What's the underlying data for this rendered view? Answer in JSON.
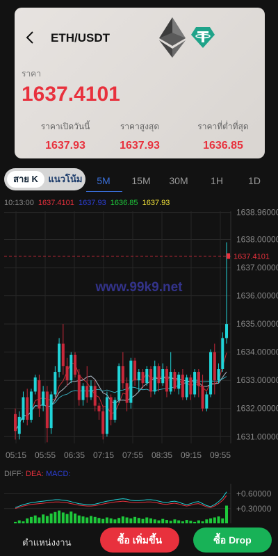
{
  "header": {
    "pair": "ETH/USDT",
    "price_label": "ราคา",
    "price": "1637.4101",
    "stats": [
      {
        "label": "ราคาเปิดวันนี้",
        "value": "1637.93"
      },
      {
        "label": "ราคาสูงสุด",
        "value": "1637.93"
      },
      {
        "label": "ราคาที่ต่ำที่สุด",
        "value": "1636.85"
      }
    ]
  },
  "tabs": {
    "chart_type_active": "สาย K",
    "chart_type_other": "แนวโน้ม",
    "timeframes": [
      "5M",
      "15M",
      "30M",
      "1H",
      "1D"
    ],
    "active_timeframe": "5M"
  },
  "ohlc": {
    "time": "10:13:00",
    "values": [
      "1637.4101",
      "1637.93",
      "1636.85",
      "1637.93"
    ],
    "colors": [
      "#e8313d",
      "#2d3fd8",
      "#1ec93b",
      "#f1e23a"
    ]
  },
  "chart_data": {
    "type": "candlestick",
    "x_labels": [
      "05:15",
      "05:55",
      "06:35",
      "07:15",
      "07:55",
      "08:35",
      "09:15",
      "09:55"
    ],
    "y_labels": [
      "1638.96000",
      "1638.00000",
      "1637.00000",
      "1636.00000",
      "1635.00000",
      "1634.00000",
      "1633.00000",
      "1632.00000",
      "1631.00000"
    ],
    "ylim": [
      1630.76,
      1639.0
    ],
    "current_price": "1637.4101",
    "watermark": "www.99k9.net",
    "colors": {
      "up": "#21d4d8",
      "down": "#c8283a",
      "ma1": "#e8313d",
      "ma2": "#c9d7e6",
      "ma3": "#3fc7d9"
    },
    "candles": [
      [
        1631.8,
        1631.2,
        1632.0,
        1630.9
      ],
      [
        1631.1,
        1631.7,
        1631.9,
        1630.9
      ],
      [
        1631.6,
        1632.4,
        1632.6,
        1631.5
      ],
      [
        1632.4,
        1631.6,
        1632.7,
        1631.4
      ],
      [
        1631.6,
        1632.6,
        1632.7,
        1631.5
      ],
      [
        1632.6,
        1633.1,
        1633.2,
        1632.5
      ],
      [
        1633.0,
        1632.0,
        1633.2,
        1631.7
      ],
      [
        1632.1,
        1632.6,
        1632.8,
        1631.9
      ],
      [
        1632.6,
        1631.3,
        1632.8,
        1630.8
      ],
      [
        1631.3,
        1632.5,
        1632.6,
        1631.1
      ],
      [
        1632.5,
        1633.3,
        1633.5,
        1632.4
      ],
      [
        1633.3,
        1634.3,
        1634.5,
        1633.1
      ],
      [
        1634.3,
        1633.5,
        1635.0,
        1633.2
      ],
      [
        1633.5,
        1633.0,
        1633.8,
        1632.8
      ],
      [
        1633.0,
        1633.9,
        1634.0,
        1632.9
      ],
      [
        1633.9,
        1633.2,
        1634.0,
        1633.1
      ],
      [
        1633.2,
        1632.3,
        1633.4,
        1632.1
      ],
      [
        1632.3,
        1632.8,
        1632.9,
        1632.1
      ],
      [
        1632.8,
        1632.4,
        1633.5,
        1632.2
      ],
      [
        1632.4,
        1632.8,
        1633.0,
        1632.3
      ],
      [
        1632.8,
        1632.1,
        1633.0,
        1631.9
      ],
      [
        1632.1,
        1631.9,
        1632.2,
        1631.6
      ],
      [
        1631.9,
        1631.1,
        1632.1,
        1630.9
      ],
      [
        1631.1,
        1632.4,
        1632.6,
        1631.0
      ],
      [
        1632.4,
        1631.6,
        1632.5,
        1631.4
      ],
      [
        1631.6,
        1632.3,
        1632.4,
        1631.5
      ],
      [
        1632.3,
        1633.5,
        1633.6,
        1632.2
      ],
      [
        1633.5,
        1632.9,
        1634.0,
        1632.7
      ],
      [
        1632.9,
        1632.2,
        1633.1,
        1631.9
      ],
      [
        1632.2,
        1633.7,
        1633.8,
        1632.0
      ],
      [
        1633.7,
        1633.0,
        1633.8,
        1632.8
      ],
      [
        1633.0,
        1633.3,
        1633.4,
        1632.6
      ],
      [
        1633.3,
        1632.9,
        1633.4,
        1632.7
      ],
      [
        1632.9,
        1633.4,
        1633.5,
        1632.8
      ],
      [
        1633.4,
        1632.6,
        1633.5,
        1632.4
      ],
      [
        1632.6,
        1633.5,
        1633.7,
        1632.5
      ],
      [
        1633.5,
        1632.9,
        1633.6,
        1632.6
      ],
      [
        1632.9,
        1633.4,
        1633.6,
        1632.8
      ],
      [
        1633.4,
        1632.6,
        1633.5,
        1632.4
      ],
      [
        1632.6,
        1633.3,
        1634.0,
        1632.5
      ],
      [
        1633.3,
        1632.7,
        1633.4,
        1632.6
      ],
      [
        1632.7,
        1633.2,
        1633.3,
        1632.5
      ],
      [
        1633.2,
        1632.4,
        1633.4,
        1632.3
      ],
      [
        1632.4,
        1633.1,
        1633.2,
        1632.3
      ],
      [
        1633.1,
        1632.5,
        1633.2,
        1632.3
      ],
      [
        1632.5,
        1633.3,
        1633.4,
        1632.4
      ],
      [
        1633.3,
        1632.8,
        1633.4,
        1632.4
      ],
      [
        1632.8,
        1632.0,
        1633.2,
        1631.9
      ],
      [
        1632.0,
        1632.5,
        1632.6,
        1631.9
      ],
      [
        1632.5,
        1634.0,
        1634.1,
        1632.4
      ],
      [
        1634.0,
        1633.0,
        1634.3,
        1632.5
      ],
      [
        1633.0,
        1633.4,
        1633.6,
        1632.9
      ],
      [
        1633.4,
        1634.5,
        1634.7,
        1633.3
      ],
      [
        1634.5,
        1635.0,
        1637.9,
        1634.3
      ]
    ]
  },
  "diff": {
    "label": "DIFF:",
    "dea_label": "DEA:",
    "macd_label": "MACD:",
    "y_labels": [
      "+0.60000",
      "+0.30000"
    ],
    "ylim": [
      0,
      0.72
    ],
    "bars": [
      0.03,
      0.06,
      0.04,
      0.1,
      0.13,
      0.16,
      0.12,
      0.18,
      0.15,
      0.2,
      0.23,
      0.26,
      0.22,
      0.19,
      0.24,
      0.2,
      0.16,
      0.14,
      0.12,
      0.15,
      0.13,
      0.11,
      0.09,
      0.12,
      0.1,
      0.08,
      0.11,
      0.14,
      0.12,
      0.1,
      0.13,
      0.11,
      0.09,
      0.12,
      0.1,
      0.08,
      0.06,
      0.09,
      0.07,
      0.05,
      0.08,
      0.06,
      0.04,
      0.07,
      0.05,
      0.03,
      0.06,
      0.04,
      0.08,
      0.1,
      0.12,
      0.14,
      0.1,
      0.36
    ],
    "line": [
      0.32,
      0.35,
      0.38,
      0.4,
      0.42,
      0.43,
      0.44,
      0.45,
      0.46,
      0.47,
      0.48,
      0.48,
      0.47,
      0.46,
      0.44,
      0.42,
      0.4,
      0.39,
      0.38,
      0.38,
      0.39,
      0.41,
      0.43,
      0.45,
      0.46,
      0.48,
      0.49,
      0.5,
      0.49,
      0.47,
      0.46,
      0.46,
      0.47,
      0.48,
      0.48,
      0.47,
      0.45,
      0.43,
      0.42,
      0.44,
      0.45,
      0.43,
      0.4,
      0.38,
      0.4,
      0.43,
      0.44,
      0.4,
      0.36,
      0.34,
      0.38,
      0.44,
      0.52,
      0.64
    ],
    "line_colors": [
      "#e8313d",
      "#21d4d8"
    ]
  },
  "bottom": {
    "position_label": "ตำแหน่งงาน",
    "buy_label": "ซื้อ เพิ่มขึ้น",
    "drop_label": "ซื้อ Drop"
  }
}
